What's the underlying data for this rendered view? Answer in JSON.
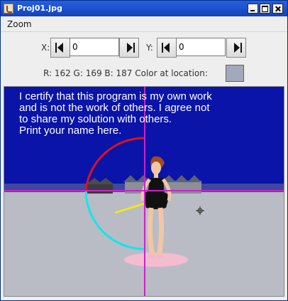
{
  "window": {
    "title": "Proj01.jpg"
  },
  "menu": {
    "items": [
      {
        "label": "Zoom"
      }
    ]
  },
  "controls": {
    "x_label": "X:",
    "x_value": "0",
    "y_label": "Y:",
    "y_value": "0",
    "color_readout": "R: 162 G: 169 B: 187 Color at location:",
    "color_swatch": "#a2a9bb"
  },
  "picture": {
    "text_lines": [
      "I certify that this program is my own work",
      "and is not the work of others. I agree not",
      "to share my solution with others.",
      "Print your name here."
    ],
    "colors": {
      "sky": "#0a14a8",
      "floor": "#b9bcc4",
      "crosshair": "#cc22cc",
      "arc_upper": "#dd1122",
      "arc_lower": "#11e6ee",
      "needle": "#f2e61a",
      "shadow": "#f4bcd0"
    }
  }
}
